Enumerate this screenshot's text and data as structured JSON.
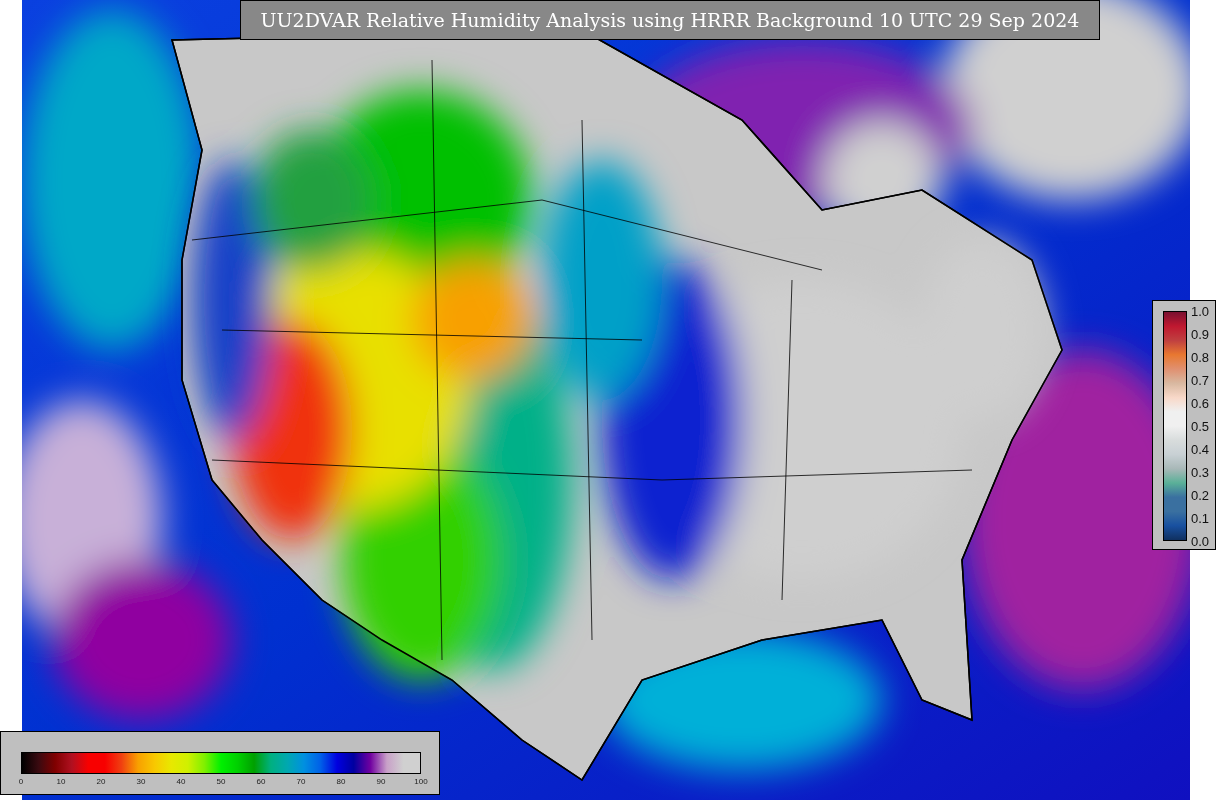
{
  "title": "UU2DVAR Relative Humidity Analysis using HRRR Background 10 UTC 29 Sep 2024",
  "humidity_colorbar": {
    "tick_labels": [
      "0",
      "10",
      "20",
      "30",
      "40",
      "50",
      "60",
      "70",
      "80",
      "90",
      "100"
    ]
  },
  "station_colorbar": {
    "tick_labels": [
      "1.0",
      "0.9",
      "0.8",
      "0.7",
      "0.6",
      "0.5",
      "0.4",
      "0.3",
      "0.2",
      "0.1",
      "0.0"
    ]
  }
}
